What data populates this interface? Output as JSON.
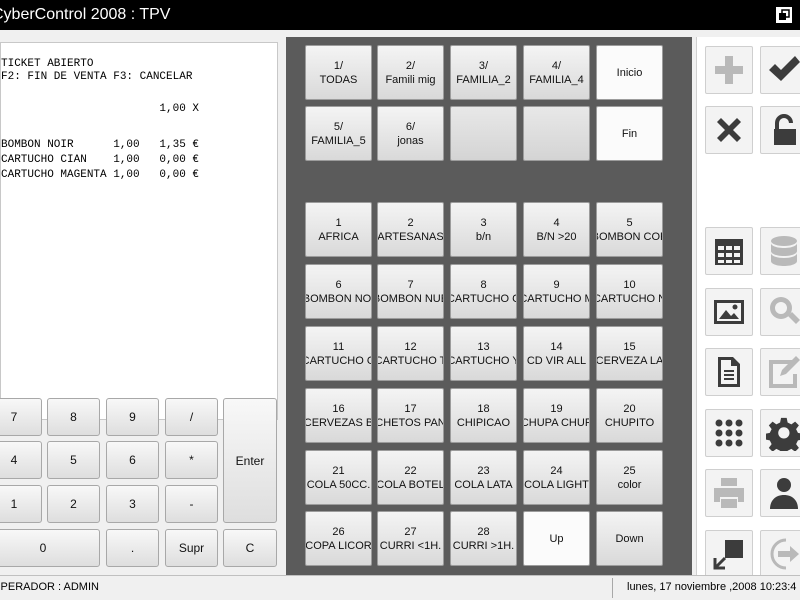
{
  "window": {
    "title": "CyberControl 2008 : TPV"
  },
  "ticket": {
    "lines": [
      "TICKET ABIERTO",
      "F2: FIN DE VENTA F3: CANCELAR",
      "",
      "                        1,00 X",
      "",
      "BOMBON NOIR      1,00   1,35 €",
      "CARTUCHO CIAN    1,00   0,00 €",
      "CARTUCHO MAGENTA 1,00   0,00 €"
    ]
  },
  "keypad": {
    "k7": "7",
    "k8": "8",
    "k9": "9",
    "kdiv": "/",
    "k4": "4",
    "k5": "5",
    "k6": "6",
    "kmul": "*",
    "k1": "1",
    "k2": "2",
    "k3": "3",
    "kmin": "-",
    "k0": "0",
    "kdot": ".",
    "supr": "Supr",
    "clear": "C",
    "enter": "Enter"
  },
  "families": [
    {
      "num": "1/",
      "name": "TODAS"
    },
    {
      "num": "2/",
      "name": "Famili mig"
    },
    {
      "num": "3/",
      "name": "FAMILIA_2"
    },
    {
      "num": "4/",
      "name": "FAMILIA_4"
    },
    {
      "num": "",
      "name": "Inicio"
    },
    {
      "num": "5/",
      "name": "FAMILIA_5"
    },
    {
      "num": "6/",
      "name": "jonas"
    },
    {
      "num": "",
      "name": ""
    },
    {
      "num": "",
      "name": ""
    },
    {
      "num": "",
      "name": "Fin"
    }
  ],
  "products": [
    {
      "num": "1",
      "name": "AFRICA"
    },
    {
      "num": "2",
      "name": "ARTESANAS"
    },
    {
      "num": "3",
      "name": "b/n"
    },
    {
      "num": "4",
      "name": "B/N >20"
    },
    {
      "num": "5",
      "name": "BOMBON COK"
    },
    {
      "num": "6",
      "name": "BOMBON NOI"
    },
    {
      "num": "7",
      "name": "BOMBON NUE"
    },
    {
      "num": "8",
      "name": "CARTUCHO C"
    },
    {
      "num": "9",
      "name": "CARTUCHO M"
    },
    {
      "num": "10",
      "name": "CARTUCHO N"
    },
    {
      "num": "11",
      "name": "CARTUCHO O"
    },
    {
      "num": "12",
      "name": "CARTUCHO T"
    },
    {
      "num": "13",
      "name": "CARTUCHO Y"
    },
    {
      "num": "14",
      "name": "CD VIR ALL"
    },
    {
      "num": "15",
      "name": "CERVEZA LA"
    },
    {
      "num": "16",
      "name": "CERVEZAS B"
    },
    {
      "num": "17",
      "name": "CHETOS PAN"
    },
    {
      "num": "18",
      "name": "CHIPICAO"
    },
    {
      "num": "19",
      "name": "CHUPA CHUP"
    },
    {
      "num": "20",
      "name": "CHUPITO"
    },
    {
      "num": "21",
      "name": "COLA 50CC."
    },
    {
      "num": "22",
      "name": "COLA BOTEL"
    },
    {
      "num": "23",
      "name": "COLA LATA"
    },
    {
      "num": "24",
      "name": "COLA LIGHT"
    },
    {
      "num": "25",
      "name": "color"
    },
    {
      "num": "26",
      "name": "COPA LICOR"
    },
    {
      "num": "27",
      "name": "CURRI <1H."
    },
    {
      "num": "28",
      "name": "CURRI >1H."
    },
    {
      "num": "",
      "name": "Up"
    },
    {
      "num": "",
      "name": "Down"
    }
  ],
  "tools": [
    {
      "icon": "plus-icon",
      "enabled": false
    },
    {
      "icon": "checkmark-icon",
      "enabled": true
    },
    {
      "icon": "cross-icon",
      "enabled": true
    },
    {
      "icon": "unlock-icon",
      "enabled": true
    },
    {
      "icon": "calendar-grid-icon",
      "enabled": true
    },
    {
      "icon": "database-icon",
      "enabled": false
    },
    {
      "icon": "picture-icon",
      "enabled": true
    },
    {
      "icon": "magnifier-icon",
      "enabled": false
    },
    {
      "icon": "document-icon",
      "enabled": true
    },
    {
      "icon": "edit-icon",
      "enabled": false
    },
    {
      "icon": "keypad-icon",
      "enabled": true
    },
    {
      "icon": "gear-icon",
      "enabled": true
    },
    {
      "icon": "printer-icon",
      "enabled": false
    },
    {
      "icon": "user-icon",
      "enabled": true
    },
    {
      "icon": "minimize-window-icon",
      "enabled": true
    },
    {
      "icon": "exit-icon",
      "enabled": false
    }
  ],
  "status": {
    "operator": "OPERADOR : ADMIN",
    "datetime": "lunes, 17 noviembre ,2008   10:23:4"
  },
  "colors": {
    "title_bg": "#000000",
    "panel_bg": "#5b5b5b",
    "icon_dark": "#3c3c3c",
    "icon_disabled": "#b9b9b9"
  }
}
